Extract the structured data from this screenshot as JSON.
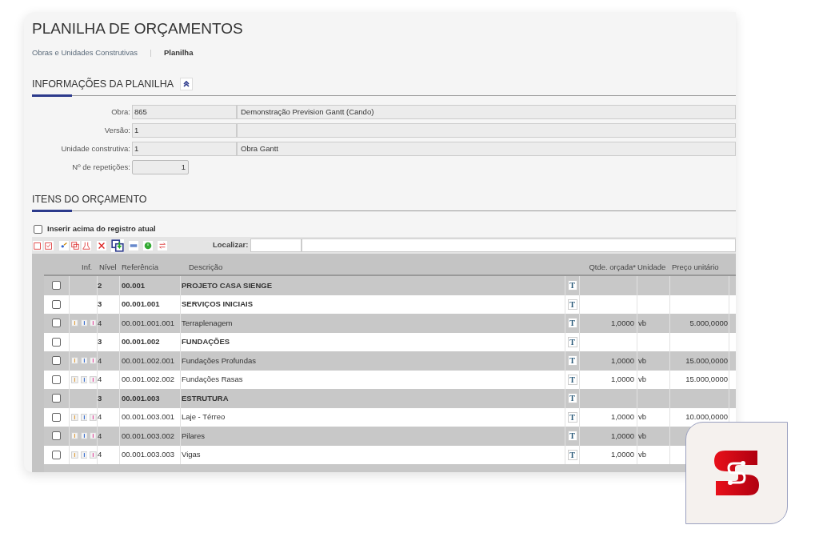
{
  "title": "PLANILHA DE ORÇAMENTOS",
  "breadcrumb": [
    {
      "label": "Obras e Unidades Construtivas",
      "selected": false
    },
    {
      "label": "Planilha",
      "selected": true
    }
  ],
  "info_section": {
    "title": "INFORMAÇÕES DA PLANILHA",
    "expanded": true
  },
  "fields": [
    {
      "label": "Obra:",
      "code": "865",
      "description": "Demonstração Prevision Gantt (Cando)"
    },
    {
      "label": "Versão:",
      "code": "1"
    },
    {
      "label": "Unidade construtiva:",
      "code": "1",
      "description": "Obra Gantt"
    },
    {
      "label": "Nº de repetições:",
      "value": "1"
    }
  ],
  "items_section": {
    "title": "ITENS DO ORÇAMENTO"
  },
  "insert_above": {
    "label": "Inserir acima do registro atual",
    "checked": false
  },
  "toolbar": {
    "search_label": "Localizar:"
  },
  "table": {
    "columns": [
      "Inf.",
      "Nível",
      "Referência",
      "Descrição",
      "Qtde. orçada*",
      "Unidade",
      "Preço unitário"
    ],
    "rows": [
      {
        "kind": "group",
        "checked": false,
        "level": "2",
        "reference": "00.001",
        "description": "PROJETO CASA SIENGE",
        "note": "T"
      },
      {
        "kind": "group",
        "checked": false,
        "level": "3",
        "reference": "00.001.001",
        "description": "SERVIÇOS INICIAIS",
        "note": "T"
      },
      {
        "kind": "item",
        "checked": false,
        "level": "4",
        "reference": "00.001.001.001",
        "description": "Terraplenagem",
        "note": "T",
        "quantity": "1,0000",
        "unit": "vb",
        "price": "5.000,0000"
      },
      {
        "kind": "group",
        "checked": false,
        "level": "3",
        "reference": "00.001.002",
        "description": "FUNDAÇÕES",
        "note": "T"
      },
      {
        "kind": "item",
        "checked": false,
        "level": "4",
        "reference": "00.001.002.001",
        "description": "Fundações Profundas",
        "note": "T",
        "quantity": "1,0000",
        "unit": "vb",
        "price": "15.000,0000"
      },
      {
        "kind": "item",
        "checked": false,
        "level": "4",
        "reference": "00.001.002.002",
        "description": "Fundações Rasas",
        "note": "T",
        "quantity": "1,0000",
        "unit": "vb",
        "price": "15.000,0000"
      },
      {
        "kind": "group",
        "checked": false,
        "level": "3",
        "reference": "00.001.003",
        "description": "ESTRUTURA",
        "note": "T"
      },
      {
        "kind": "item",
        "checked": false,
        "level": "4",
        "reference": "00.001.003.001",
        "description": "Laje - Térreo",
        "note": "T",
        "quantity": "1,0000",
        "unit": "vb",
        "price": "10.000,0000"
      },
      {
        "kind": "item",
        "checked": false,
        "level": "4",
        "reference": "00.001.003.002",
        "description": "Pilares",
        "note": "T",
        "quantity": "1,0000",
        "unit": "vb"
      },
      {
        "kind": "item",
        "checked": false,
        "level": "4",
        "reference": "00.001.003.003",
        "description": "Vigas",
        "note": "T",
        "quantity": "1,0000",
        "unit": "vb"
      }
    ]
  }
}
